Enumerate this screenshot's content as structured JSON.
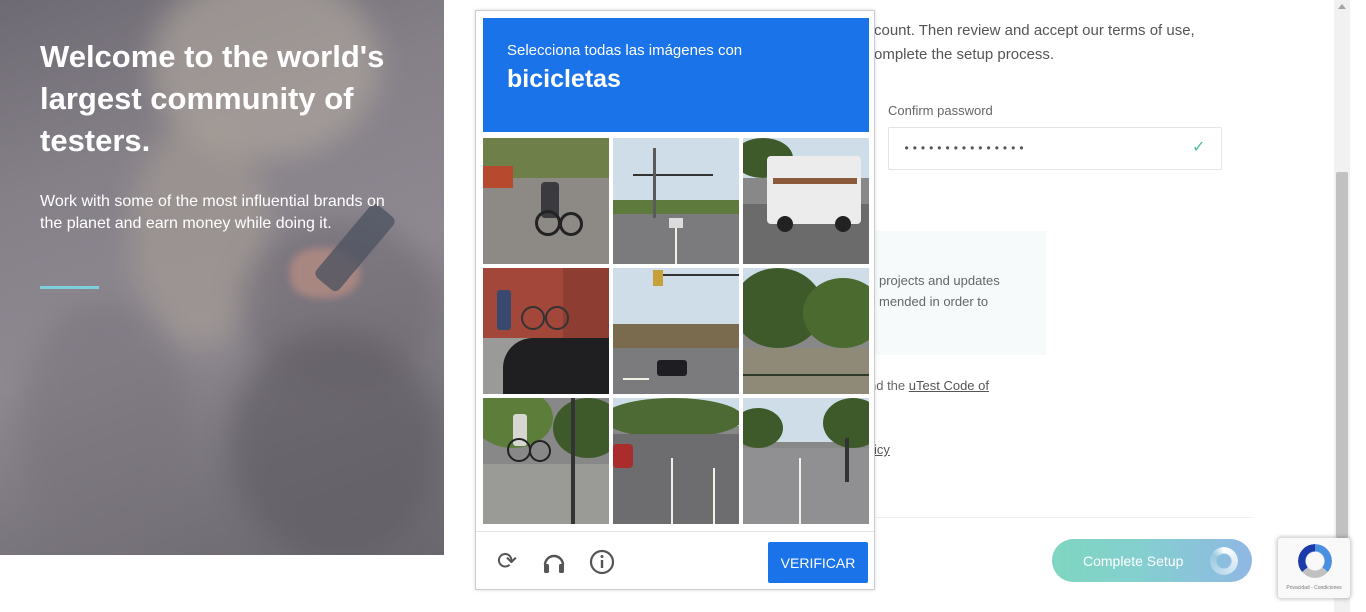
{
  "hero": {
    "title": "Welcome to the world's largest community of testers.",
    "subtitle": "Work with some of the most influential brands on the planet and earn money while doing it."
  },
  "form": {
    "intro_line1": "count. Then review and accept our terms of use,",
    "intro_line2": "omplete the setup process.",
    "confirm_password_label": "Confirm password",
    "confirm_password_value": "•••••••••••••••",
    "info_line1": "projects and updates",
    "info_line2": "mended in order to",
    "agree_prefix": "nd the ",
    "code_link": "uTest Code of",
    "policy_link": "icy",
    "complete_button": "Complete Setup"
  },
  "captcha": {
    "instruction": "Selecciona todas las imágenes con",
    "target": "bicicletas",
    "verify_button": "VERIFICAR",
    "icons": [
      "reload-icon",
      "audio-icon",
      "info-icon"
    ],
    "accent_color": "#1a73e8"
  },
  "recaptcha_badge": {
    "text": "Privacidad - Condiciones"
  }
}
